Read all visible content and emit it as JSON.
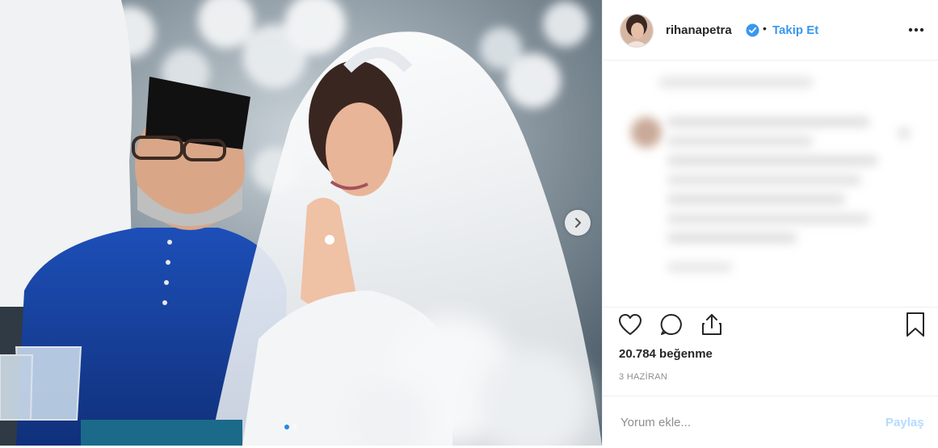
{
  "post": {
    "username": "rihanapetra",
    "separator": "•",
    "follow_label": "Takip Et",
    "likes": "20.784 beğenme",
    "date": "3 HAZİRAN",
    "comment_placeholder": "Yorum ekle...",
    "post_label": "Paylaş"
  },
  "icons": {
    "verified": "verified-badge-icon",
    "more": "more-options-icon",
    "like": "heart-icon",
    "comment": "comment-bubble-icon",
    "share": "share-icon",
    "save": "bookmark-icon",
    "next": "chevron-right-icon"
  },
  "carousel": {
    "slide_count": 2,
    "active_index": 0
  },
  "colors": {
    "link_blue": "#3897f0",
    "verified_blue": "#3897f0",
    "post_disabled": "#b3dbff",
    "muted": "#8e8e8e",
    "border": "#efefef"
  }
}
